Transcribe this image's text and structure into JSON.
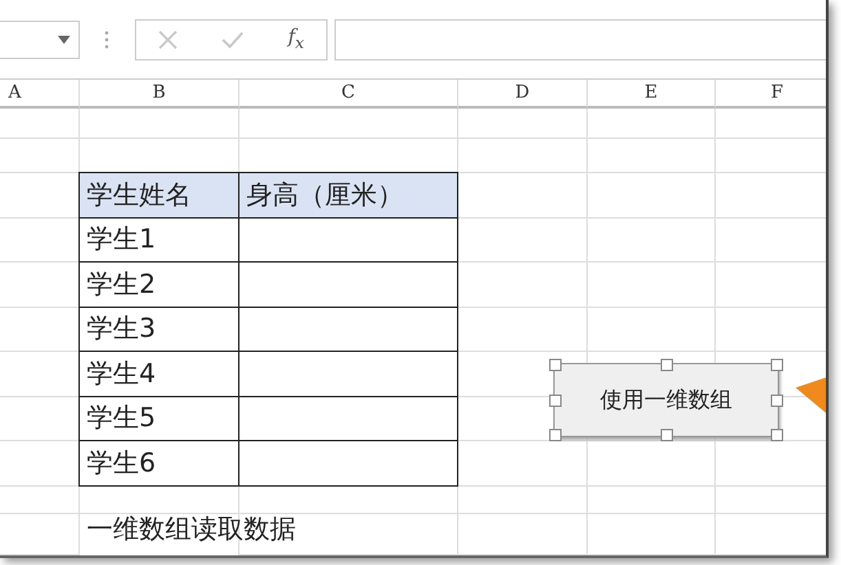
{
  "formula_bar": {
    "fx": "f$_{x}$"
  },
  "columns": [
    "A",
    "B",
    "C",
    "D",
    "E",
    "F"
  ],
  "table": {
    "headers": [
      "学生姓名",
      "身高（厘米）"
    ],
    "rows": [
      "学生1",
      "学生2",
      "学生3",
      "学生4",
      "学生5",
      "学生6"
    ]
  },
  "caption": "一维数组读取数据",
  "button": {
    "label": "使用一维数组",
    "selected": true
  }
}
